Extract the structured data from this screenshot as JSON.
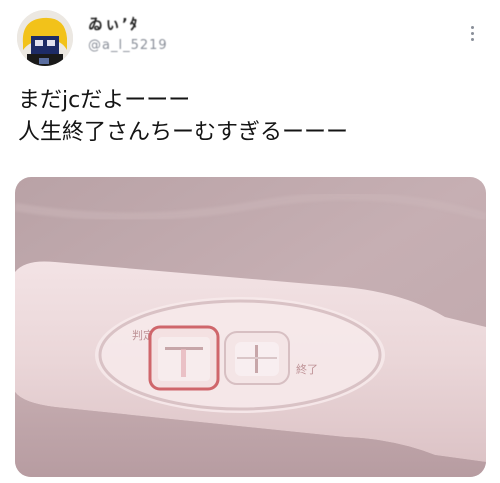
{
  "tweet": {
    "author_name": "ゐぃ’ﾀ",
    "author_handle": "@a_l_5219",
    "text_lines": [
      "まだjcだよーーー",
      "人生終了さんちーむすぎるーーー"
    ],
    "more_icon": "more-vertical-icon"
  },
  "photo": {
    "label_left": "判定",
    "label_right": "終了",
    "colors": {
      "background": "#c9b2b6",
      "device": "#eedbdd",
      "window_ring": "#d1696d"
    }
  }
}
